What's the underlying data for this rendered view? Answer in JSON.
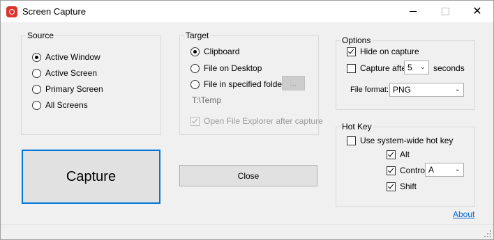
{
  "window": {
    "title": "Screen Capture",
    "close_glyph": "✕",
    "accent_color": "#0078d7",
    "icon": "camera-icon"
  },
  "source": {
    "legend": "Source",
    "options": [
      {
        "label": "Active Window",
        "selected": true
      },
      {
        "label": "Active Screen",
        "selected": false
      },
      {
        "label": "Primary Screen",
        "selected": false
      },
      {
        "label": "All Screens",
        "selected": false
      }
    ]
  },
  "target": {
    "legend": "Target",
    "options": [
      {
        "label": "Clipboard",
        "selected": true
      },
      {
        "label": "File on Desktop",
        "selected": false
      },
      {
        "label": "File in specified folder",
        "selected": false
      }
    ],
    "browse_label": "...",
    "folder_path": "T:\\Temp",
    "open_explorer_label": "Open File Explorer after capture",
    "open_explorer_checked": true
  },
  "options": {
    "legend": "Options",
    "hide_on_capture_label": "Hide on capture",
    "hide_on_capture_checked": true,
    "capture_after_label": "Capture after",
    "capture_after_checked": false,
    "capture_after_value": "5",
    "seconds_label": "seconds",
    "file_format_label": "File format:",
    "file_format_value": "PNG"
  },
  "hotkey": {
    "legend": "Hot Key",
    "use_hotkey_label": "Use system-wide hot key",
    "use_hotkey_checked": false,
    "alt_label": "Alt",
    "alt_checked": true,
    "control_label": "Control",
    "control_checked": true,
    "key_value": "A",
    "shift_label": "Shift",
    "shift_checked": true
  },
  "buttons": {
    "capture_label": "Capture",
    "close_label": "Close"
  },
  "about_label": "About"
}
